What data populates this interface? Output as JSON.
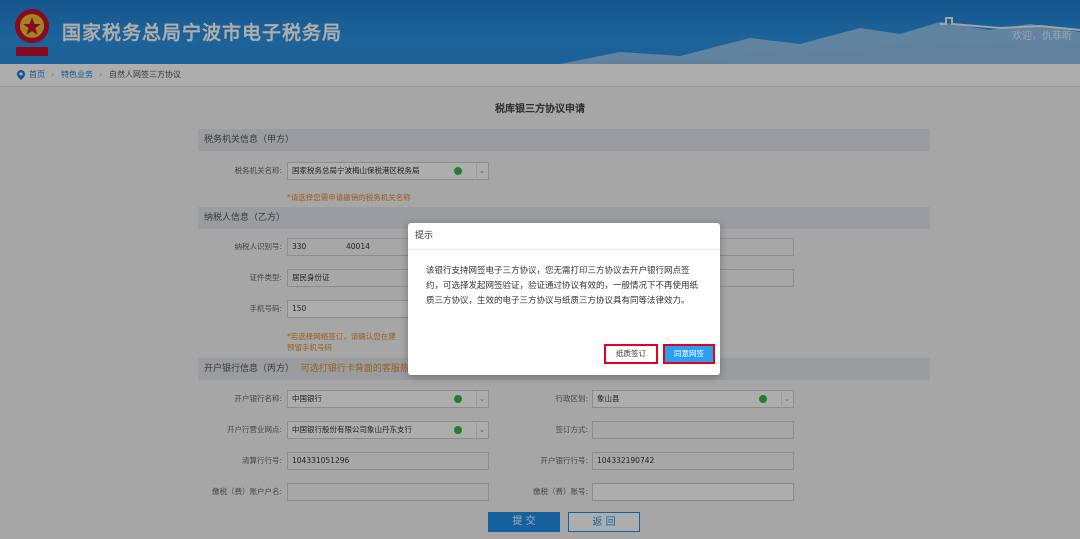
{
  "header": {
    "title": "国家税务总局宁波市电子税务局",
    "user_text": "欢迎，仇菲昕",
    "emblem_caption": "中国税务"
  },
  "breadcrumb": {
    "home": "首页",
    "category": "特色业务",
    "current": "自然人网签三方协议"
  },
  "page": {
    "title": "税库银三方协议申请"
  },
  "section_a": {
    "title": "税务机关信息（甲方）",
    "tax_office_label": "税务机关名称:",
    "tax_office_value": "国家税务总局宁波梅山保税港区税务局",
    "hint": "*请选择您需申请撤销的税务机关名称"
  },
  "section_b": {
    "title": "纳税人信息（乙方）",
    "taxpayer_id_label": "纳税人识别号:",
    "taxpayer_id_value_a": "330",
    "taxpayer_id_value_b": "40014",
    "id_type_label": "证件类型:",
    "id_type_value": "居民身份证",
    "phone_label": "手机号码:",
    "phone_value": "150",
    "hint_line1": "*若选择网络签订，请确认您在建",
    "hint_line2": "预留手机号码"
  },
  "section_c": {
    "title": "开户银行信息（丙方）",
    "title_hint": "可选打银行卡背面的客服热线",
    "bank_name_label": "开户银行名称:",
    "bank_name_value": "中国银行",
    "branch_label": "开户行营业网点:",
    "branch_value": "中国银行股份有限公司象山丹东支行",
    "clearing_label": "清算行行号:",
    "clearing_value": "104331051296",
    "account_name_label": "缴税（费）账户户名:",
    "region_label": "行政区划:",
    "region_value": "象山县",
    "sign_method_label": "签订方式:",
    "bank_no_label": "开户银行行号:",
    "bank_no_value": "104332190742",
    "account_no_label": "缴税（费）账号:"
  },
  "buttons": {
    "submit": "提 交",
    "back": "返 回"
  },
  "dialog": {
    "title": "提示",
    "message": "该银行支持网签电子三方协议，您无需打印三方协议去开户银行网点签约，可选择发起网签验证，验证通过协议有效的，一般情况下不再使用纸质三方协议，生效的电子三方协议与纸质三方协议具有同等法律效力。",
    "paper_button": "纸质签订",
    "online_button": "同意网签"
  },
  "colors": {
    "header_blue": "#2a8fe0",
    "primary_button": "#1e90e8",
    "hint_orange": "#e58a2e",
    "highlight_red": "#e6001e"
  }
}
